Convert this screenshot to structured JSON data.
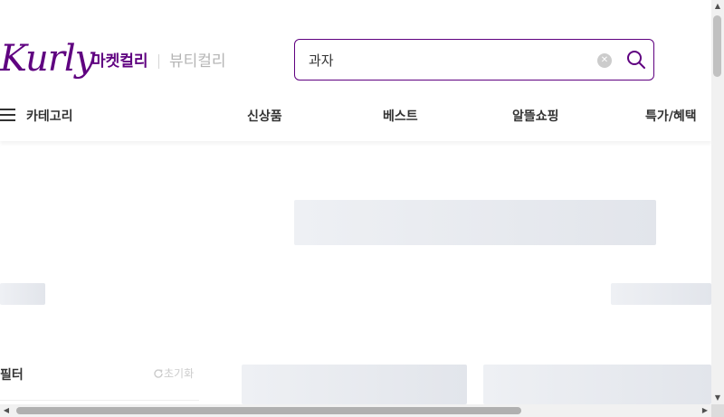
{
  "header": {
    "logo_text": "Kurly",
    "tabs": {
      "market": "마켓컬리",
      "beauty": "뷰티컬리"
    },
    "search": {
      "value": "과자",
      "clear_icon": "clear-circle-icon",
      "search_icon": "search-icon"
    }
  },
  "gnb": {
    "category_label": "카테고리",
    "menu_icon": "hamburger-menu-icon",
    "items": [
      "신상품",
      "베스트",
      "알뜰쇼핑",
      "특가/혜택"
    ]
  },
  "filter": {
    "title": "필터",
    "reset_label": "초기화",
    "reset_icon": "refresh-icon"
  },
  "colors": {
    "brand": "#5f0080",
    "skeleton": "#e9ebef",
    "muted_text": "#b5b5b5"
  }
}
